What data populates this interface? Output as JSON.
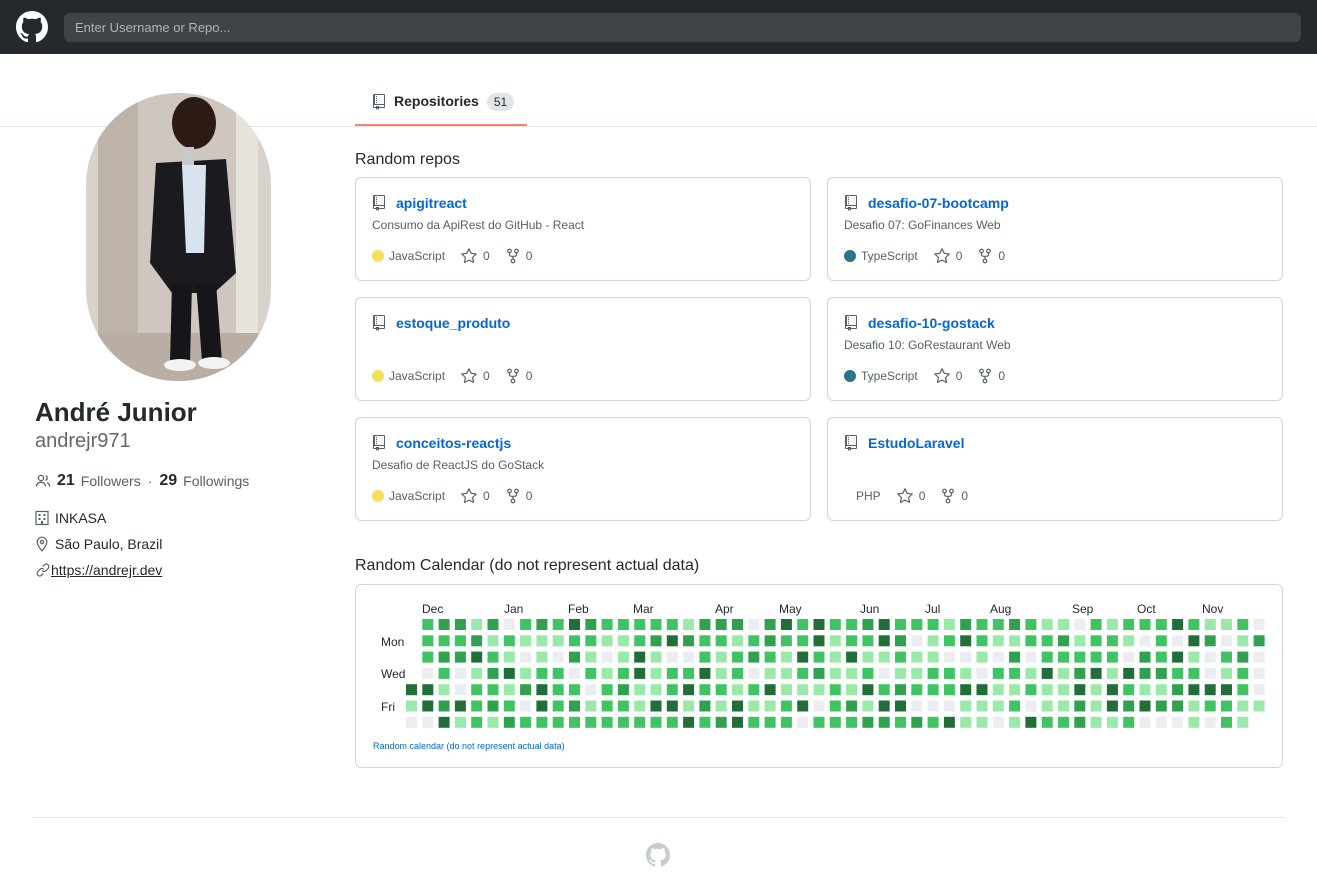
{
  "header": {
    "logo_icon": "github-mark-icon",
    "search_placeholder": "Enter Username or Repo..."
  },
  "profile": {
    "name": "André Junior",
    "login": "andrejr971",
    "followers_count": "21",
    "followers_label": "Followers",
    "separator": "·",
    "following_count": "29",
    "following_label": "Followings",
    "company": "INKASA",
    "location": "São Paulo, Brazil",
    "website": "https://andrejr.dev"
  },
  "tabs": {
    "repositories_label": "Repositories",
    "repositories_count": "51"
  },
  "random_repos_title": "Random repos",
  "repos": [
    {
      "name": "apigitreact",
      "description": "Consumo da ApiRest do GitHub - React",
      "language": "JavaScript",
      "language_color": "#f1e05a",
      "stars": "0",
      "forks": "0"
    },
    {
      "name": "desafio-07-bootcamp",
      "description": "Desafio 07: GoFinances Web",
      "language": "TypeScript",
      "language_color": "#2b7489",
      "stars": "0",
      "forks": "0"
    },
    {
      "name": "estoque_produto",
      "description": "",
      "language": "JavaScript",
      "language_color": "#f1e05a",
      "stars": "0",
      "forks": "0"
    },
    {
      "name": "desafio-10-gostack",
      "description": "Desafio 10: GoRestaurant Web",
      "language": "TypeScript",
      "language_color": "#2b7489",
      "stars": "0",
      "forks": "0"
    },
    {
      "name": "conceitos-reactjs",
      "description": "Desafio de ReactJS do GoStack",
      "language": "JavaScript",
      "language_color": "#f1e05a",
      "stars": "0",
      "forks": "0"
    },
    {
      "name": "EstudoLaravel",
      "description": "",
      "language": "PHP",
      "language_color": "",
      "stars": "0",
      "forks": "0"
    }
  ],
  "calendar": {
    "title": "Random Calendar (do not represent actual data)",
    "note": "Random calendar (do not represent actual data)",
    "months": [
      "Dec",
      "Jan",
      "Feb",
      "Mar",
      "Apr",
      "May",
      "Jun",
      "Jul",
      "Aug",
      "Sep",
      "Oct",
      "Nov"
    ],
    "days": [
      "Mon",
      "Wed",
      "Fri"
    ],
    "colors": [
      "#ebedf0",
      "#9be9a8",
      "#40c463",
      "#30a14e",
      "#216e39"
    ]
  },
  "footer": {
    "logo_icon": "github-mark-icon"
  }
}
